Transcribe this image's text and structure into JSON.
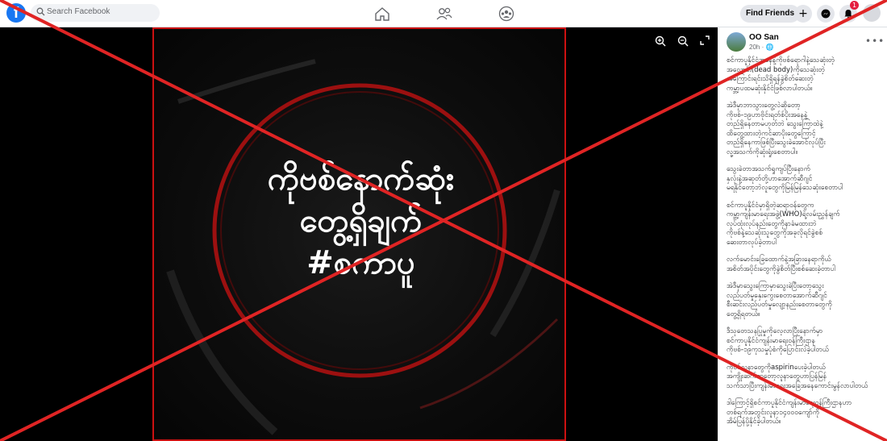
{
  "search": {
    "placeholder": "Search Facebook"
  },
  "header_right": {
    "find_friends": "Find Friends",
    "plus": "+",
    "notif_count": "1"
  },
  "media": {
    "headline_lines": [
      "ကိုဗစ်နောက်ဆုံး",
      "တွေ့ရှိချက်",
      "#စကာပူ"
    ]
  },
  "post": {
    "author": "OO San",
    "time": "20h · 🌐",
    "paragraphs": [
      "စင်ကာပူနိုင်ငံအနေနဲ့ကိုဗစ်ရောဂါနဲ့သေဆုံးတဲ့\nအလောင်း(dead body)ကိုသေဆုံးတဲ့\nအကြောင်းရင်းသိရှိရန်ခွဲစိတ်ဆေးတဲ့\nကမ္ဘာ့ပထမဆုံးနိုင်ငံဖြစ်လာပါတယ်။",
      "အဲဒီမှာဘာသွားတွေ့လဲဆိုတော့\nကိုဗစ်-၁၉ဟာဗိုင်းရတ်စ်ပိုးအနေနဲ့\nတည်ရှိနေတာမဟုတ်ဘဲ သွေးကြောထဲနဲ့\nထိတွေ့ထားတဲ့ကင်ဆာပိုးတွေကြောင့်\nတည်ရှိနေကာဖြစ်ပြီးသွေးခဲအောင်လုပ်ပြီး\nလူ့အသက်ကိုဆုံးရှုံးစေတာပါ။",
      "သွေးခဲတာအသက်ရှုကျပ်ပြီးနောက်\nနှလုံးနဲ့အဆုတ်တို့ဟာအောက်ဆီဂျင်\nမရနိုင်တော့ဘဲလူတွေကိုမြန်မြန်သေဆုံးစေတာပါ",
      "စင်ကာပူနိုင်ငံမှာရှိတဲ့ဆရာဝန်တွေက\nကမ္ဘာ့ကျန်းမာရေးအဖွဲ့(WHO)ရဲ့လမ်းညွှန်ချက်\nလုပ်ထုံးလုပ်နည်းတွေကိုနာခံမထားဘဲ\nကိုဗစ်နဲ့သေဆုံးသူတွေကိုအခုလိုရင်ခွဲစစ်\nဆေးတာလုပ်ခဲ့တာပါ",
      "လက်မောင်းခြေထောက်နဲ့အခြားနေရာကိုယ်\nအစိတ်အပိုင်းတွေကိုခွဲစိတ်ပြီးစစ်ဆေးခဲ့တာပါ",
      "အဲဒီမှာသွေးကြောမှာသွေးခဲပြီးတော့သွေး\nလည်ပတ်မှုနှေးကွေးစေတာအောက်ဆီဂျင်\nစီးဆင်းလည်ပတ်မှုလျော့နည်းစေတာတွေကို\nတွေ့ရှိရတယ်။",
      "ဒီသုတေသနပြုမှုကိုလေ့လာပြီးနောက်မှာ\nစင်ကာပူနိုင်ငံကျန်းမာရေးဝန်ကြီးဌာန\nကိုဗစ်-၁၉ကုသမှုပုံစံကိုပြောင်းလဲခဲ့ပါတယ်",
      "ကိုဗစ်လူနာတွေကိုaspirinပေးခဲ့ပါတယ်\nအကျိုးဆက်ကတော့လူနာတွေဟာပြန်မြန်\nသက်သာပြီးကျန်းမာရေးအခြေအနေကောင်းမွန်လာပါတယ်",
      "ဒါကြောင့်ရှိစင်ကာပူနိုင်ငံကျန်းမာရေးဝန်ကြီးဌာနဟာ\nတစ်ရက်အတွင်းလူနာ၁၄၀၀၀ကျော်ကို\nအိမ်ပြန်ပို့နိုင်ခဲ့ပါတယ်။"
    ]
  },
  "colors": {
    "brand": "#1877f2",
    "cross": "#e02424"
  }
}
